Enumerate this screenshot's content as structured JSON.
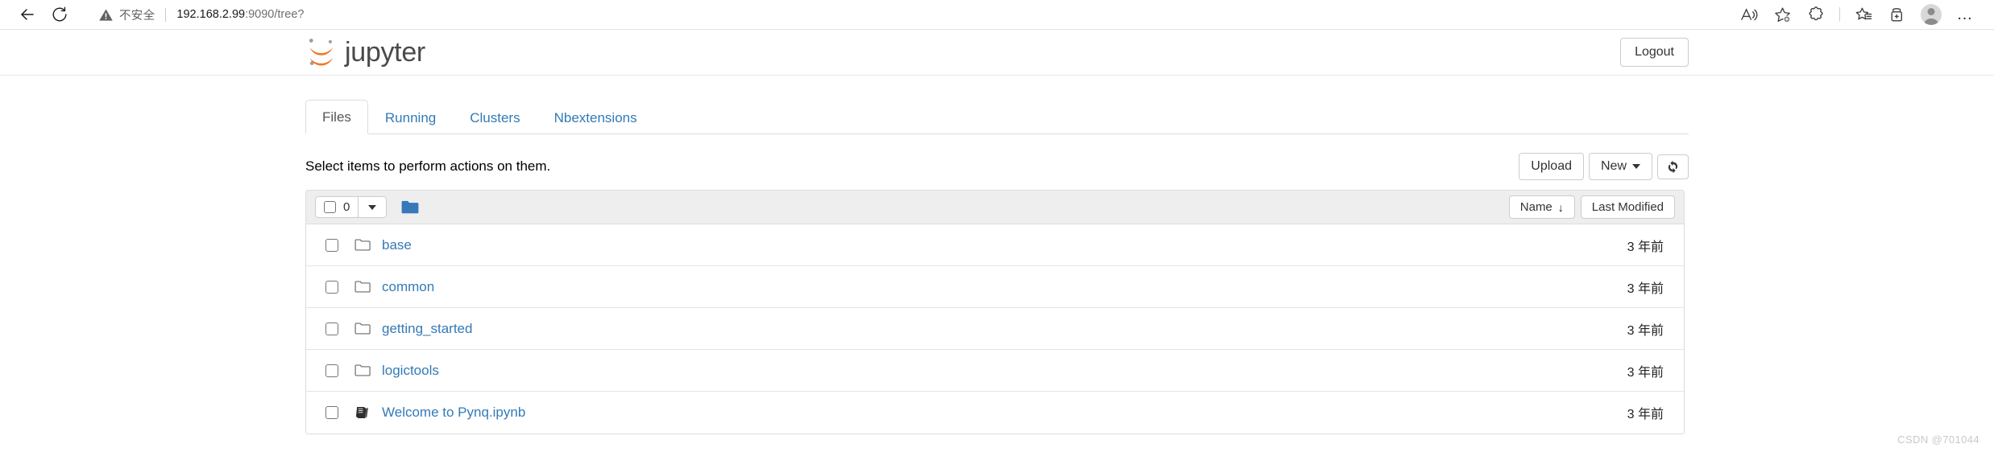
{
  "browser": {
    "back_icon": "back-arrow-icon",
    "reload_icon": "reload-icon",
    "security_label": "不安全",
    "url_host": "192.168.2.99",
    "url_port_path": ":9090/tree?",
    "actions": [
      {
        "name": "read-aloud-icon",
        "label": "Read aloud"
      },
      {
        "name": "add-favorite-icon",
        "label": "Add this page to favorites"
      },
      {
        "name": "extensions-icon",
        "label": "Extensions"
      },
      {
        "name": "favorites-icon",
        "label": "Favorites"
      },
      {
        "name": "collections-icon",
        "label": "Collections"
      },
      {
        "name": "profile-avatar",
        "label": "Profile"
      },
      {
        "name": "settings-more-icon",
        "label": "Settings and more"
      }
    ],
    "more_glyph": "…"
  },
  "jupyter": {
    "brand": "jupyter",
    "logout_label": "Logout",
    "tabs": [
      {
        "label": "Files",
        "active": true
      },
      {
        "label": "Running",
        "active": false
      },
      {
        "label": "Clusters",
        "active": false
      },
      {
        "label": "Nbextensions",
        "active": false
      }
    ],
    "hint": "Select items to perform actions on them.",
    "upload_label": "Upload",
    "new_label": "New",
    "refresh_icon": "refresh-icon",
    "toolbar": {
      "selected_count": "0",
      "folder_icon": "folder-icon",
      "name_column": "Name",
      "sort_arrow": "↓",
      "modified_column": "Last Modified"
    },
    "files": [
      {
        "name": "base",
        "type": "folder",
        "modified": "3 年前"
      },
      {
        "name": "common",
        "type": "folder",
        "modified": "3 年前"
      },
      {
        "name": "getting_started",
        "type": "folder",
        "modified": "3 年前"
      },
      {
        "name": "logictools",
        "type": "folder",
        "modified": "3 年前"
      },
      {
        "name": "Welcome to Pynq.ipynb",
        "type": "notebook",
        "modified": "3 年前"
      }
    ]
  },
  "watermark": "CSDN @701044",
  "colors": {
    "link_blue": "#337ab7",
    "jupyter_orange": "#f37726",
    "folder_blue": "#3778b8",
    "header_gray": "#eeeeee"
  }
}
